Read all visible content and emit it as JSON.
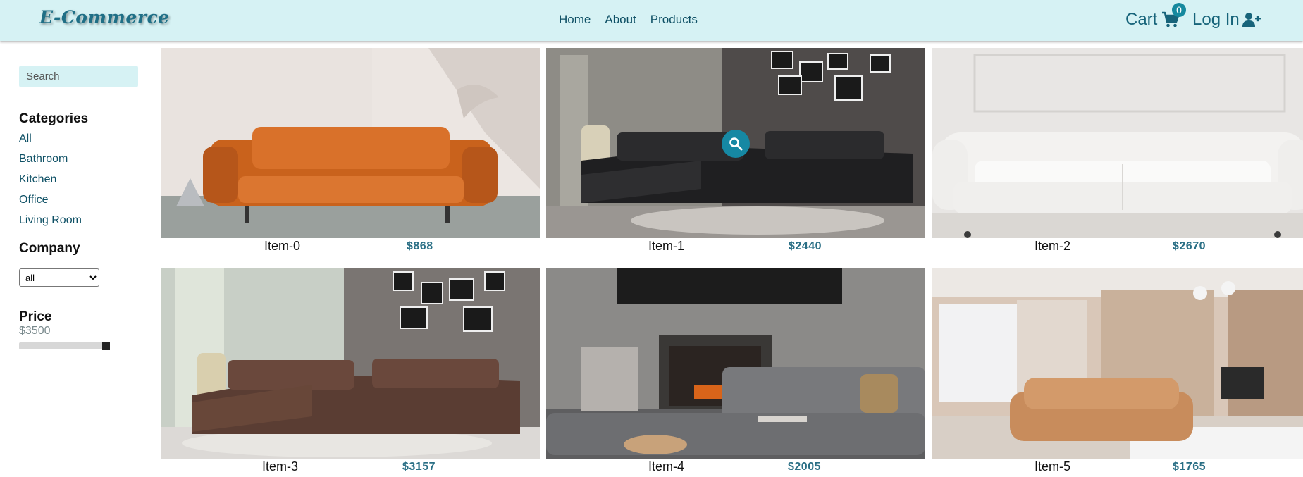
{
  "header": {
    "logo": "E-Commerce",
    "nav": [
      "Home",
      "About",
      "Products"
    ],
    "cart_label": "Cart",
    "cart_count": "0",
    "login_label": "Log In"
  },
  "sidebar": {
    "search_placeholder": "Search",
    "categories_title": "Categories",
    "categories": [
      "All",
      "Bathroom",
      "Kitchen",
      "Office",
      "Living Room"
    ],
    "company_title": "Company",
    "company_selected": "all",
    "price_title": "Price",
    "price_value": "$3500",
    "price_level": 1.0
  },
  "products": [
    {
      "name": "Item-0",
      "price": "$868",
      "image": "orange leather sofa"
    },
    {
      "name": "Item-1",
      "price": "$2440",
      "image": "black sectional sofa"
    },
    {
      "name": "Item-2",
      "price": "$2670",
      "image": "white chesterfield sofa"
    },
    {
      "name": "Item-3",
      "price": "$3157",
      "image": "brown sectional sofa"
    },
    {
      "name": "Item-4",
      "price": "$2005",
      "image": "grey sofa with fireplace"
    },
    {
      "name": "Item-5",
      "price": "$1765",
      "image": "tan sofa in open room"
    }
  ],
  "icons": {
    "cart": "cart-icon",
    "login": "user-plus-icon",
    "zoom": "search-icon",
    "select": "chevron-down-icon"
  },
  "colors": {
    "accent": "#d6f2f4",
    "brand": "#17647a",
    "price": "#2a6f85",
    "badge": "#15899e"
  }
}
